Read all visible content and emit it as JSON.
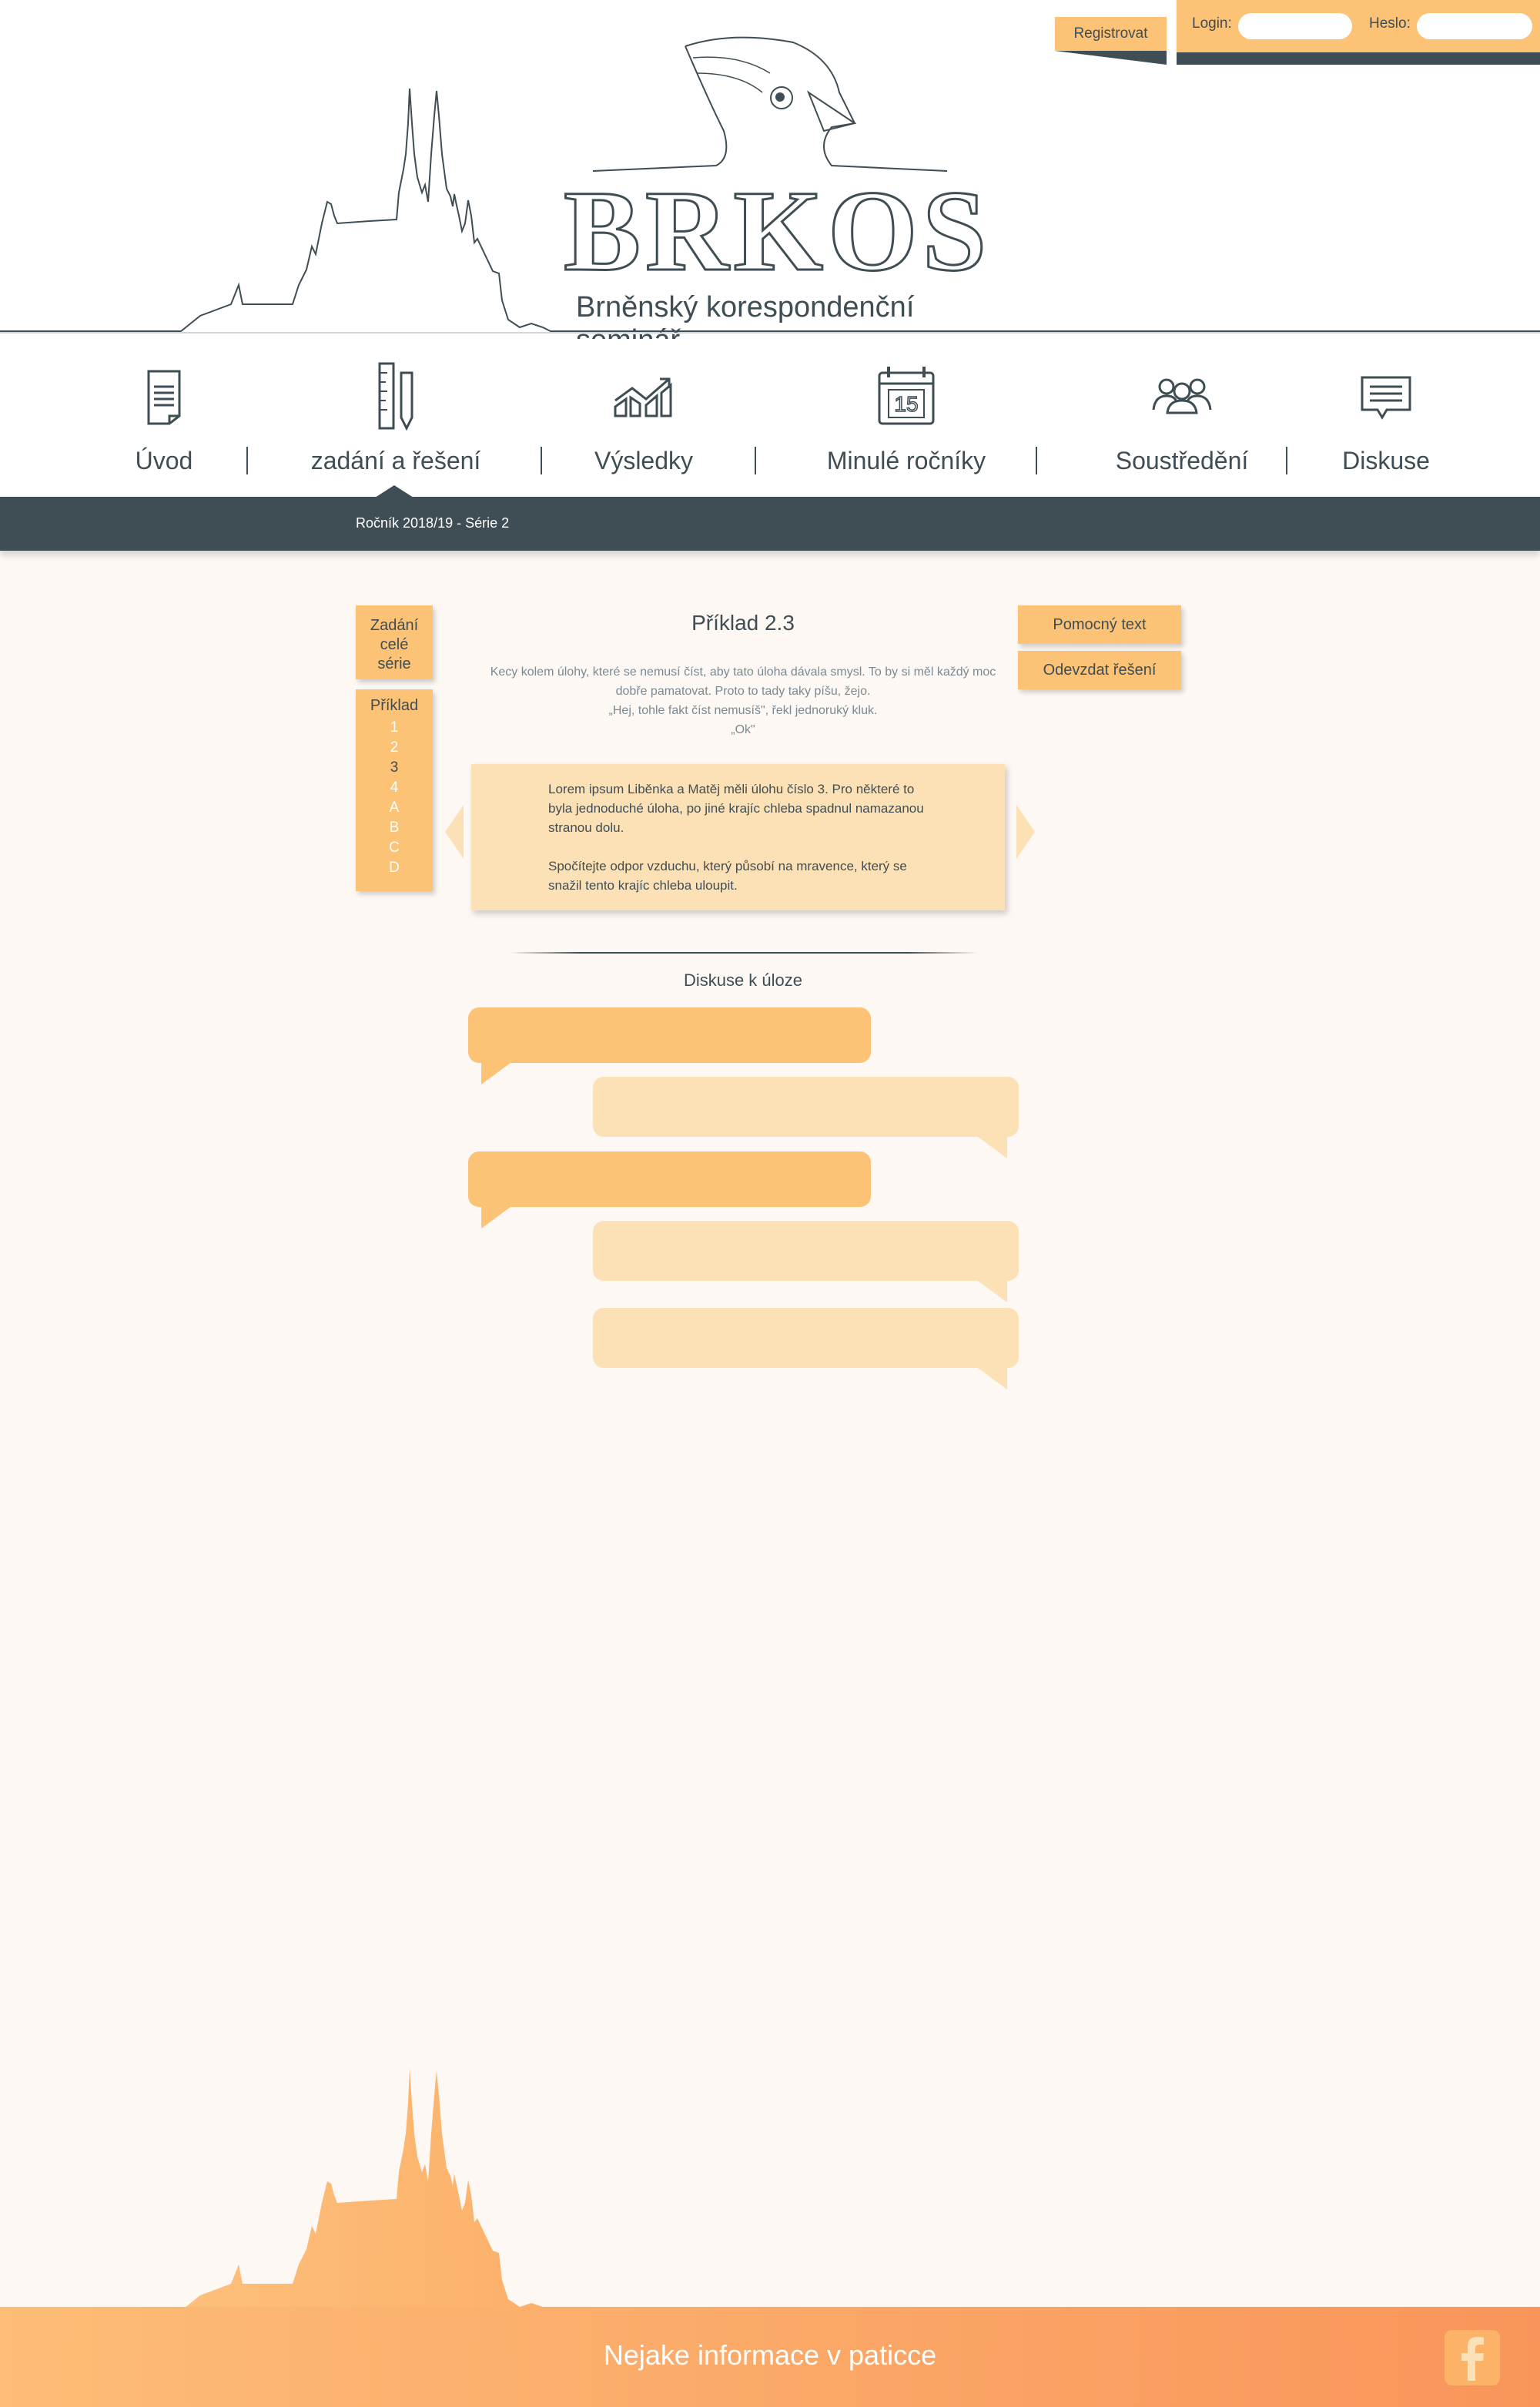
{
  "header": {
    "register_label": "Registrovat",
    "login_label": "Login:",
    "password_label": "Heslo:",
    "logo_title": "BRKOS",
    "logo_subtitle": "Brněnský korespondenční seminář"
  },
  "nav": {
    "items": [
      {
        "label": "Úvod",
        "icon": "document-icon"
      },
      {
        "label": "zadání a řešení",
        "icon": "ruler-pencil-icon"
      },
      {
        "label": "Výsledky",
        "icon": "chart-icon"
      },
      {
        "label": "Minulé ročníky",
        "icon": "calendar-icon",
        "icon_text": "15"
      },
      {
        "label": "Soustředění",
        "icon": "people-icon"
      },
      {
        "label": "Diskuse",
        "icon": "chat-icon"
      }
    ],
    "active": "zadání a řešení"
  },
  "subbar": {
    "text": "Ročník 2018/19 - Série 2"
  },
  "sidebar": {
    "whole_series_lines": [
      "Zadání",
      "celé",
      "série"
    ],
    "problems_heading": "Příklad",
    "problems": [
      "1",
      "2",
      "3",
      "4",
      "A",
      "B",
      "C",
      "D"
    ],
    "active_problem": "3"
  },
  "actions": {
    "help_text_label": "Pomocný text",
    "submit_label": "Odevzdat řešení"
  },
  "problem": {
    "title": "Příklad 2.3",
    "intro_lines": [
      "Kecy kolem úlohy, které se nemusí číst, aby tato úloha dávala smysl. To by si měl každý moc",
      "dobře pamatovat. Proto to tady taky píšu, žejo.",
      "„Hej, tohle fakt číst nemusíš\", řekl jednoruký kluk.",
      "„Ok\""
    ],
    "task_paragraph_1": "Lorem ipsum Liběnka a Matěj měli úlohu číslo 3. Pro některé to byla jednoduché úloha, po jiné krajíc chleba spadnul namazanou stranou dolu.",
    "task_paragraph_2": "Spočítejte odpor vzduchu, který působí na mravence, který se snažil tento krajíc chleba uloupit."
  },
  "discussion": {
    "title": "Diskuse k úloze",
    "messages": [
      "left",
      "right",
      "left",
      "right",
      "right"
    ]
  },
  "footer": {
    "text": "Nejake informace v paticce",
    "social_icon": "facebook-icon"
  },
  "colors": {
    "accent": "#fcc377",
    "accent_light": "#fde1b6",
    "dark": "#3f4d54",
    "background": "#fdf8f4"
  }
}
